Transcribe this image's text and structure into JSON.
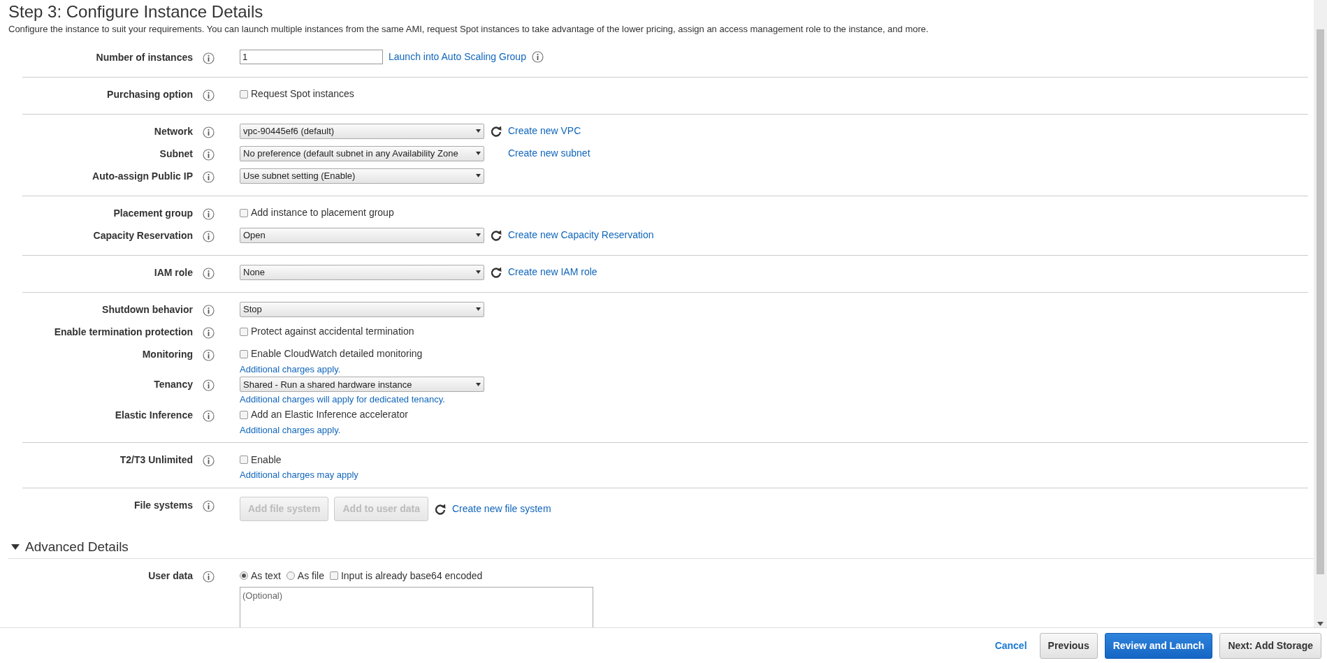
{
  "header": {
    "title": "Step 3: Configure Instance Details",
    "description": "Configure the instance to suit your requirements. You can launch multiple instances from the same AMI, request Spot instances to take advantage of the lower pricing, assign an access management role to the instance, and more."
  },
  "sections": [
    {
      "rows": [
        {
          "label": "Number of instances",
          "items": [
            {
              "kind": "input",
              "value": "1"
            },
            {
              "kind": "link",
              "text": "Launch into Auto Scaling Group"
            },
            {
              "kind": "info"
            }
          ]
        }
      ]
    },
    {
      "rows": [
        {
          "label": "Purchasing option",
          "items": [
            {
              "kind": "checkbox",
              "text": "Request Spot instances",
              "checked": false
            }
          ]
        }
      ]
    },
    {
      "rows": [
        {
          "label": "Network",
          "items": [
            {
              "kind": "select",
              "value": "vpc-90445ef6 (default)"
            },
            {
              "kind": "refresh"
            },
            {
              "kind": "link",
              "text": "Create new VPC"
            }
          ]
        },
        {
          "label": "Subnet",
          "items": [
            {
              "kind": "select",
              "value": "No preference (default subnet in any Availability Zone"
            },
            {
              "kind": "spacer"
            },
            {
              "kind": "link",
              "text": "Create new subnet"
            }
          ]
        },
        {
          "label": "Auto-assign Public IP",
          "items": [
            {
              "kind": "select",
              "value": "Use subnet setting (Enable)"
            }
          ]
        }
      ]
    },
    {
      "rows": [
        {
          "label": "Placement group",
          "items": [
            {
              "kind": "checkbox",
              "text": "Add instance to placement group",
              "checked": false
            }
          ]
        },
        {
          "label": "Capacity Reservation",
          "items": [
            {
              "kind": "select",
              "value": "Open"
            },
            {
              "kind": "refresh"
            },
            {
              "kind": "link",
              "text": "Create new Capacity Reservation"
            }
          ]
        }
      ]
    },
    {
      "rows": [
        {
          "label": "IAM role",
          "items": [
            {
              "kind": "select",
              "value": "None"
            },
            {
              "kind": "refresh"
            },
            {
              "kind": "link",
              "text": "Create new IAM role"
            }
          ]
        }
      ]
    },
    {
      "rows": [
        {
          "label": "Shutdown behavior",
          "items": [
            {
              "kind": "select",
              "value": "Stop"
            }
          ]
        },
        {
          "label": "Enable termination protection",
          "items": [
            {
              "kind": "checkbox",
              "text": "Protect against accidental termination",
              "checked": false
            }
          ]
        },
        {
          "label": "Monitoring",
          "items": [
            {
              "kind": "checkbox",
              "text": "Enable CloudWatch detailed monitoring",
              "checked": false
            }
          ],
          "note": "Additional charges apply."
        },
        {
          "label": "Tenancy",
          "items": [
            {
              "kind": "select",
              "value": "Shared - Run a shared hardware instance"
            }
          ],
          "note": "Additional charges will apply for dedicated tenancy."
        },
        {
          "label": "Elastic Inference",
          "items": [
            {
              "kind": "checkbox",
              "text": "Add an Elastic Inference accelerator",
              "checked": false
            }
          ],
          "note": "Additional charges apply."
        }
      ]
    },
    {
      "rows": [
        {
          "label": "T2/T3 Unlimited",
          "items": [
            {
              "kind": "checkbox",
              "text": "Enable",
              "checked": false
            }
          ],
          "note": "Additional charges may apply"
        }
      ]
    },
    {
      "rows": [
        {
          "label": "File systems",
          "items": [
            {
              "kind": "button",
              "text": "Add file system",
              "disabled": true
            },
            {
              "kind": "button",
              "text": "Add to user data",
              "disabled": true
            },
            {
              "kind": "refresh"
            },
            {
              "kind": "link",
              "text": "Create new file system"
            }
          ]
        }
      ]
    }
  ],
  "advanced": {
    "title": "Advanced Details",
    "expanded": true,
    "rows": [
      {
        "label": "User data",
        "items": [
          {
            "kind": "radio",
            "text": "As text",
            "selected": true
          },
          {
            "kind": "radio",
            "text": "As file",
            "selected": false
          },
          {
            "kind": "checkbox",
            "text": "Input is already base64 encoded",
            "checked": false
          }
        ],
        "textarea": {
          "placeholder": "(Optional)"
        }
      }
    ]
  },
  "footer": {
    "cancel": "Cancel",
    "buttons": [
      {
        "text": "Previous",
        "kind": "secondary"
      },
      {
        "text": "Review and Launch",
        "kind": "primary"
      },
      {
        "text": "Next: Add Storage",
        "kind": "secondary"
      }
    ]
  }
}
